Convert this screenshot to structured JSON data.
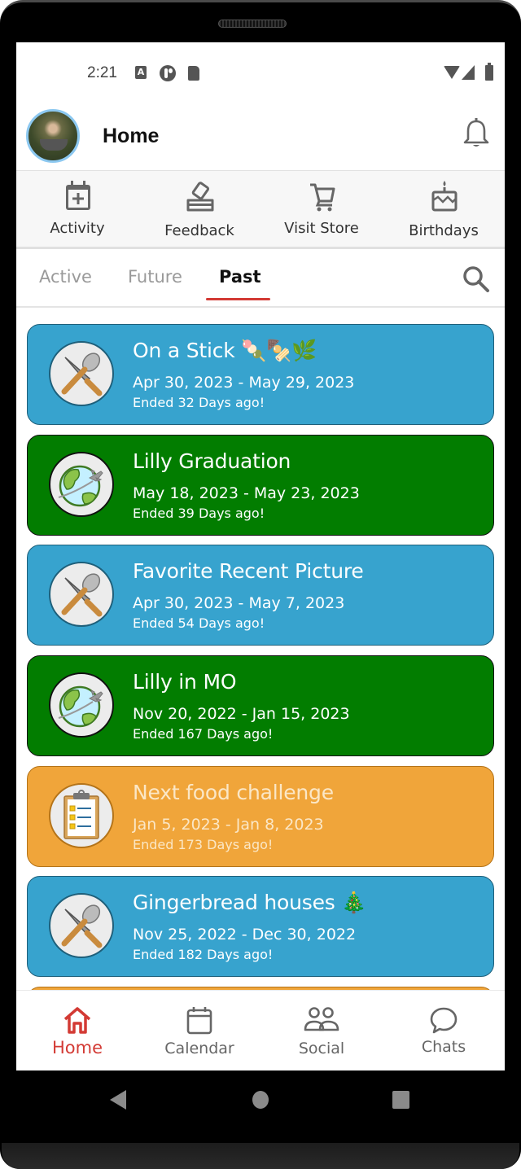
{
  "status_bar": {
    "time": "2:21",
    "icons": [
      "a-badge-icon",
      "p-app-icon",
      "sd-card-icon",
      "wifi-icon",
      "signal-icon",
      "battery-icon"
    ]
  },
  "header": {
    "title": "Home",
    "avatar_icon": "user-avatar",
    "notification_icon": "bell-icon"
  },
  "quick_actions": [
    {
      "label": "Activity",
      "icon": "calendar-plus-icon"
    },
    {
      "label": "Feedback",
      "icon": "ballot-box-icon"
    },
    {
      "label": "Visit Store",
      "icon": "cart-icon"
    },
    {
      "label": "Birthdays",
      "icon": "cake-icon"
    }
  ],
  "tabs": {
    "items": [
      {
        "label": "Active",
        "active": false
      },
      {
        "label": "Future",
        "active": false
      },
      {
        "label": "Past",
        "active": true
      }
    ],
    "search_icon": "search-icon",
    "accent_color": "#d33a34"
  },
  "events": [
    {
      "title": "On a Stick 🍡🍢🌿",
      "dates": "Apr 30, 2023 - May 29, 2023",
      "ended": "Ended 32 Days ago!",
      "color": "blue",
      "icon": "knife-spoon-icon"
    },
    {
      "title": "Lilly Graduation",
      "dates": "May 18, 2023 - May 23, 2023",
      "ended": "Ended 39 Days ago!",
      "color": "green",
      "icon": "globe-plane-icon"
    },
    {
      "title": "Favorite Recent Picture",
      "dates": "Apr 30, 2023 - May 7, 2023",
      "ended": "Ended 54 Days ago!",
      "color": "blue",
      "icon": "knife-spoon-icon"
    },
    {
      "title": "Lilly in MO",
      "dates": "Nov 20, 2022 - Jan 15, 2023",
      "ended": "Ended 167 Days ago!",
      "color": "green",
      "icon": "globe-plane-icon"
    },
    {
      "title": "Next food challenge",
      "dates": "Jan 5, 2023 - Jan 8, 2023",
      "ended": "Ended 173 Days ago!",
      "color": "orange",
      "icon": "clipboard-checklist-icon"
    },
    {
      "title": "Gingerbread houses 🎄",
      "dates": "Nov 25, 2022 - Dec 30, 2022",
      "ended": "Ended 182 Days ago!",
      "color": "blue",
      "icon": "knife-spoon-icon"
    }
  ],
  "card_colors": {
    "blue": "#37a3ce",
    "green": "#027d00",
    "orange": "#f0a53a"
  },
  "bottom_nav": [
    {
      "label": "Home",
      "icon": "home-icon",
      "active": true
    },
    {
      "label": "Calendar",
      "icon": "calendar-icon",
      "active": false
    },
    {
      "label": "Social",
      "icon": "people-icon",
      "active": false
    },
    {
      "label": "Chats",
      "icon": "chat-bubble-icon",
      "active": false
    }
  ],
  "system_nav": [
    "back-icon",
    "home-circle-icon",
    "recents-icon"
  ]
}
